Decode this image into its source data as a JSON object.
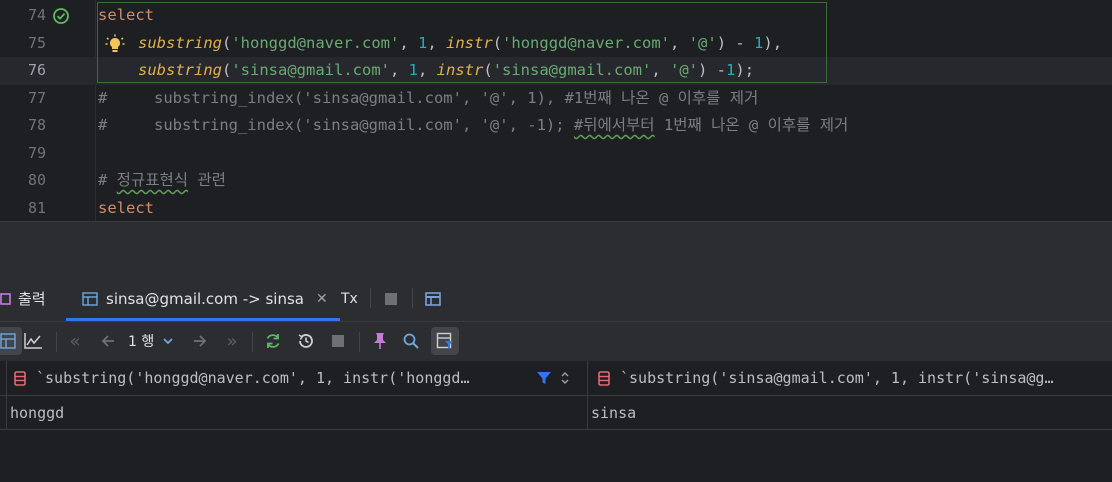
{
  "editor": {
    "lines": [
      {
        "num": "74"
      },
      {
        "num": "75"
      },
      {
        "num": "76"
      },
      {
        "num": "77"
      },
      {
        "num": "78"
      },
      {
        "num": "79"
      },
      {
        "num": "80"
      },
      {
        "num": "81"
      }
    ],
    "tokens": {
      "select": "select",
      "substring": "substring",
      "instr": "instr",
      "open": "(",
      "comma": ", ",
      "s1": "'honggd@naver.com'",
      "s2": "'sinsa@gmail.com'",
      "at": "'@'",
      "one": "1",
      "minus": " - ",
      "minus2": " -",
      "close": ")",
      "close_comma": "),",
      "close_semi": ");",
      "c77a": "#     substring_index('sinsa@gmail.com', '@', 1), #1번째 나온 @ 이후를 제거",
      "c78a": "#     substring_index('sinsa@gmail.com', '@', -1); ",
      "c78b": "#뒤에서부터",
      "c78c": " 1번째 나온 @ 이후를 제거",
      "c80a": "# ",
      "c80b": "정규표현식",
      "c80c": " 관련"
    }
  },
  "tabs": [
    {
      "label": "출력"
    },
    {
      "label": "sinsa@gmail.com -> sinsa"
    },
    {
      "label": "Tx"
    }
  ],
  "toolbar": {
    "page_label": "1 행"
  },
  "grid": {
    "columns": [
      "`substring('honggd@naver.com', 1, instr('honggd…",
      "`substring('sinsa@gmail.com', 1, instr('sinsa@g…"
    ],
    "rows": [
      [
        "honggd",
        "sinsa"
      ]
    ]
  },
  "colors": {
    "accent": "#3574f0",
    "keyword": "#cf8e6d",
    "string": "#6aab73",
    "number": "#2aacb8",
    "function": "#e0b14b",
    "comment": "#7a7e85"
  }
}
